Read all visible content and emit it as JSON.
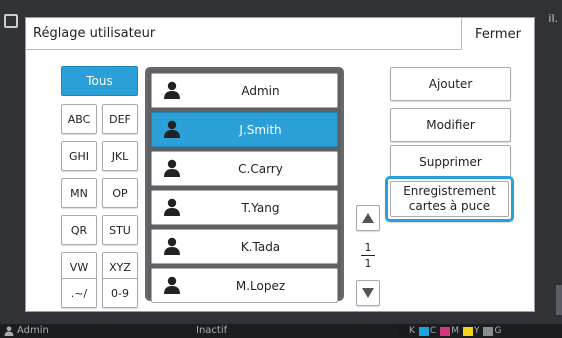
{
  "background": {
    "title_fragment": "il."
  },
  "dialog": {
    "title": "Réglage utilisateur",
    "close_label": "Fermer"
  },
  "filters": {
    "all_label": "Tous",
    "buttons": [
      "ABC",
      "DEF",
      "GHI",
      "JKL",
      "MN",
      "OP",
      "QR",
      "STU",
      "VW",
      "XYZ",
      ".~/",
      "0-9"
    ]
  },
  "users": {
    "items": [
      {
        "name": "Admin",
        "selected": false
      },
      {
        "name": "J.Smith",
        "selected": true
      },
      {
        "name": "C.Carry",
        "selected": false
      },
      {
        "name": "T.Yang",
        "selected": false
      },
      {
        "name": "K.Tada",
        "selected": false
      },
      {
        "name": "M.Lopez",
        "selected": false
      }
    ]
  },
  "pagination": {
    "current": "1",
    "total": "1"
  },
  "actions": {
    "add_label": "Ajouter",
    "modify_label": "Modifier",
    "delete_label": "Supprimer",
    "card_register_line1": "Enregistrement",
    "card_register_line2": "cartes à puce"
  },
  "status_bar": {
    "user": "Admin",
    "state": "Inactif",
    "inks": [
      {
        "label": "K",
        "color": "#1a1a1a"
      },
      {
        "label": "C",
        "color": "#18a4de"
      },
      {
        "label": "M",
        "color": "#d6357e"
      },
      {
        "label": "Y",
        "color": "#f2d21b"
      },
      {
        "label": "G",
        "color": "#8a8c90"
      }
    ]
  },
  "colors": {
    "accent": "#2a9fd8",
    "list_frame": "#66686c"
  }
}
